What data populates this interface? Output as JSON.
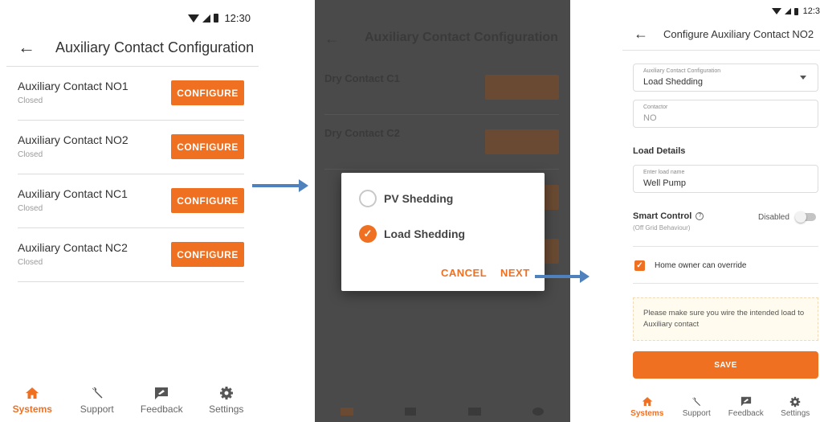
{
  "colors": {
    "accent": "#f07021",
    "arrow": "#4f81bd",
    "overlay": "#4a4a4a"
  },
  "screen1": {
    "status": {
      "time": "12:30"
    },
    "title": "Auxiliary Contact Configuration",
    "items": [
      {
        "name": "Auxiliary Contact NO1",
        "state": "Closed",
        "button": "CONFIGURE"
      },
      {
        "name": "Auxiliary Contact NO2",
        "state": "Closed",
        "button": "CONFIGURE"
      },
      {
        "name": "Auxiliary Contact NC1",
        "state": "Closed",
        "button": "CONFIGURE"
      },
      {
        "name": "Auxiliary Contact NC2",
        "state": "Closed",
        "button": "CONFIGURE"
      }
    ],
    "nav": [
      {
        "label": "Systems",
        "icon": "home-icon",
        "active": true
      },
      {
        "label": "Support",
        "icon": "wrench-icon",
        "active": false
      },
      {
        "label": "Feedback",
        "icon": "feedback-icon",
        "active": false
      },
      {
        "label": "Settings",
        "icon": "gear-icon",
        "active": false
      }
    ]
  },
  "screen2": {
    "background": {
      "title": "Auxiliary Contact Configuration",
      "items": [
        "Dry Contact C1",
        "Dry Contact C2"
      ]
    },
    "dialog": {
      "options": [
        {
          "label": "PV Shedding",
          "selected": false
        },
        {
          "label": "Load Shedding",
          "selected": true
        }
      ],
      "cancel": "CANCEL",
      "next": "NEXT"
    }
  },
  "screen3": {
    "status": {
      "time": "12:3"
    },
    "title": "Configure Auxiliary Contact NO2",
    "config_field": {
      "label": "Auxiliary Contact Configuration",
      "value": "Load Shedding"
    },
    "contactor_field": {
      "label": "Contactor",
      "value": "NO"
    },
    "load_details_title": "Load Details",
    "load_name_field": {
      "label": "Enter load name",
      "value": "Well Pump"
    },
    "smart_control": {
      "label": "Smart Control",
      "sub": "(Off Grid Behaviour)",
      "state": "Disabled",
      "on": false
    },
    "override": {
      "label": "Home owner can override",
      "checked": true
    },
    "notice": "Please make sure you wire the intended load to Auxiliary contact",
    "save": "SAVE",
    "nav": [
      {
        "label": "Systems",
        "icon": "home-icon",
        "active": true
      },
      {
        "label": "Support",
        "icon": "wrench-icon",
        "active": false
      },
      {
        "label": "Feedback",
        "icon": "feedback-icon",
        "active": false
      },
      {
        "label": "Settings",
        "icon": "gear-icon",
        "active": false
      }
    ]
  }
}
